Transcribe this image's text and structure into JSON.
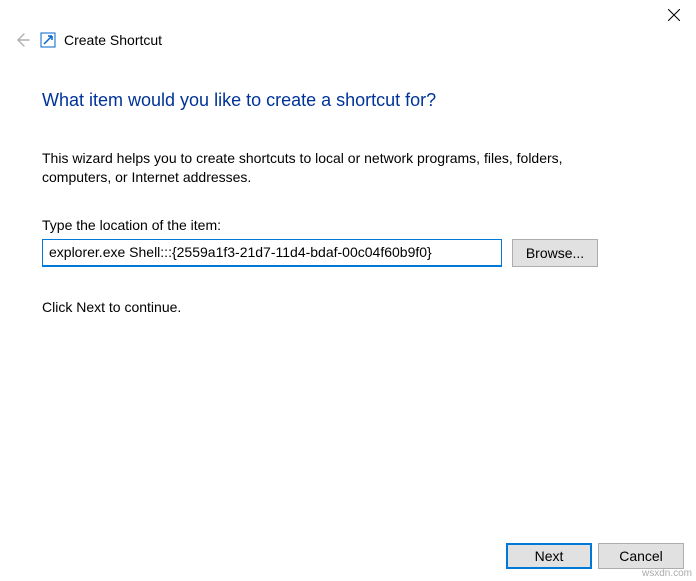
{
  "titlebar": {
    "close_tooltip": "Close"
  },
  "header": {
    "title": "Create Shortcut"
  },
  "content": {
    "heading": "What item would you like to create a shortcut for?",
    "description": "This wizard helps you to create shortcuts to local or network programs, files, folders, computers, or Internet addresses.",
    "input_label": "Type the location of the item:",
    "location_value": "explorer.exe Shell:::{2559a1f3-21d7-11d4-bdaf-00c04f60b9f0}",
    "browse_label": "Browse...",
    "continue_text": "Click Next to continue."
  },
  "footer": {
    "next_label": "Next",
    "cancel_label": "Cancel"
  },
  "watermark": "wsxdn.com"
}
